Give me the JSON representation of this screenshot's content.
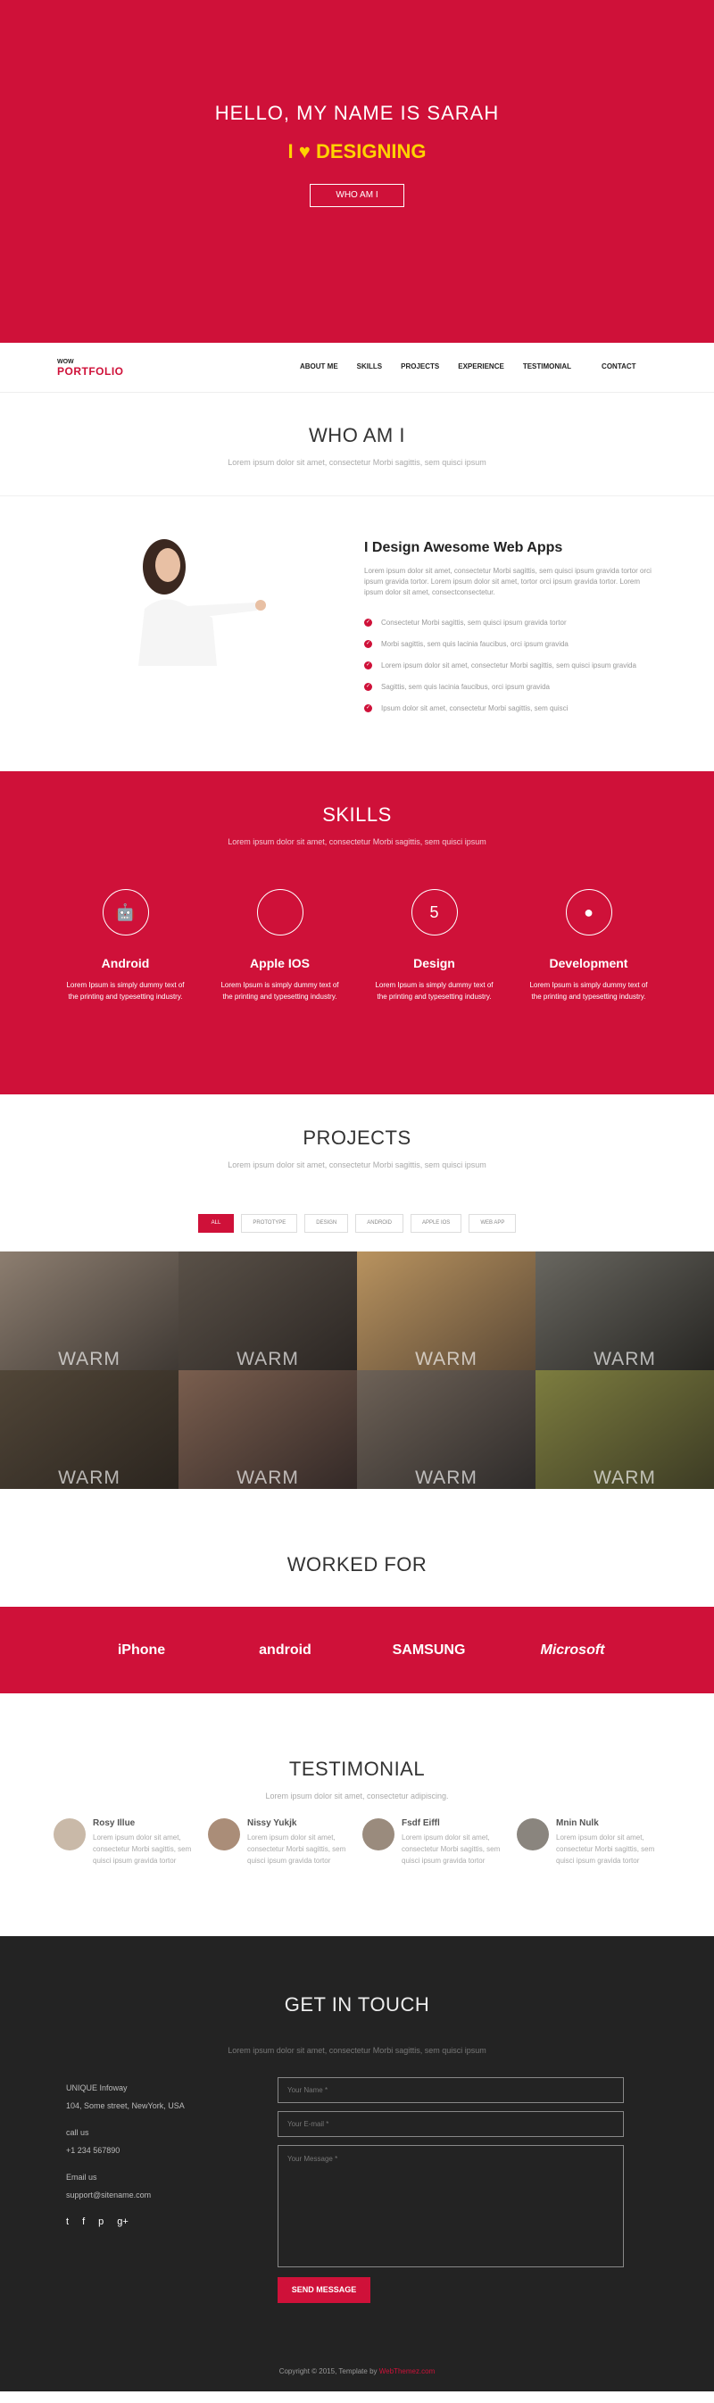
{
  "hero": {
    "title": "HELLO, MY NAME IS SARAH",
    "love_left": "I",
    "love_right": "DESIGNING",
    "button": "WHO AM I"
  },
  "logo": {
    "top": "WOW",
    "bottom": "PORTFOLIO"
  },
  "nav": [
    "ABOUT ME",
    "SKILLS",
    "PROJECTS",
    "EXPERIENCE",
    "TESTIMONIAL",
    "CONTACT"
  ],
  "who": {
    "title": "WHO AM I",
    "subtitle": "Lorem ipsum dolor sit amet, consectetur Morbi sagittis, sem quisci ipsum"
  },
  "about": {
    "heading": "I Design Awesome Web Apps",
    "text": "Lorem ipsum dolor sit amet, consectetur Morbi sagittis, sem quisci ipsum gravida tortor orci ipsum gravida tortor. Lorem ipsum dolor sit amet, tortor orci ipsum gravida tortor. Lorem ipsum dolor sit amet, consectconsectetur.",
    "checks": [
      "Consectetur Morbi sagittis, sem quisci ipsum gravida tortor",
      "Morbi sagittis, sem quis lacinia faucibus, orci ipsum gravida",
      "Lorem ipsum dolor sit amet, consectetur Morbi sagittis, sem quisci ipsum gravida",
      "Sagittis, sem quis lacinia faucibus, orci ipsum gravida",
      "Ipsum dolor sit amet, consectetur Morbi sagittis, sem quisci"
    ]
  },
  "skills": {
    "title": "SKILLS",
    "subtitle": "Lorem ipsum dolor sit amet, consectetur Morbi sagittis, sem quisci ipsum",
    "items": [
      {
        "name": "Android",
        "icon": "android",
        "desc": "Lorem Ipsum is simply dummy text of the printing and typesetting industry."
      },
      {
        "name": "Apple IOS",
        "icon": "apple",
        "desc": "Lorem Ipsum is simply dummy text of the printing and typesetting industry."
      },
      {
        "name": "Design",
        "icon": "html5",
        "desc": "Lorem Ipsum is simply dummy text of the printing and typesetting industry."
      },
      {
        "name": "Development",
        "icon": "user",
        "desc": "Lorem Ipsum is simply dummy text of the printing and typesetting industry."
      }
    ]
  },
  "projects": {
    "title": "PROJECTS",
    "subtitle": "Lorem ipsum dolor sit amet, consectetur Morbi sagittis, sem quisci ipsum",
    "filters": [
      "ALL",
      "PROTOTYPE",
      "DESIGN",
      "ANDROID",
      "APPLE IOS",
      "WEB APP"
    ],
    "tiles": [
      "WARM",
      "WARM",
      "WARM",
      "WARM",
      "WARM",
      "WARM",
      "WARM",
      "WARM"
    ]
  },
  "worked": {
    "title": "WORKED FOR",
    "brands": [
      "iPhone",
      "android",
      "SAMSUNG",
      "Microsoft"
    ]
  },
  "testimonial": {
    "title": "TESTIMONIAL",
    "subtitle": "Lorem ipsum dolor sit amet, consectetur adipiscing.",
    "items": [
      {
        "name": "Rosy Illue",
        "text": "Lorem ipsum dolor sit amet, consectetur Morbi sagittis, sem quisci ipsum gravida tortor"
      },
      {
        "name": "Nissy Yukjk",
        "text": "Lorem ipsum dolor sit amet, consectetur Morbi sagittis, sem quisci ipsum gravida tortor"
      },
      {
        "name": "Fsdf Eiffl",
        "text": "Lorem ipsum dolor sit amet, consectetur Morbi sagittis, sem quisci ipsum gravida tortor"
      },
      {
        "name": "Mnin Nulk",
        "text": "Lorem ipsum dolor sit amet, consectetur Morbi sagittis, sem quisci ipsum gravida tortor"
      }
    ]
  },
  "contact": {
    "title": "GET IN TOUCH",
    "subtitle": "Lorem ipsum dolor sit amet, consectetur Morbi sagittis, sem quisci ipsum",
    "company": "UNIQUE Infoway",
    "address": "104, Some street, NewYork, USA",
    "call_label": "call us",
    "phone": "+1 234 567890",
    "email_label": "Email us",
    "email": "support@sitename.com",
    "name_placeholder": "Your Name *",
    "email_placeholder": "Your E-mail *",
    "message_placeholder": "Your Message *",
    "send": "SEND MESSAGE"
  },
  "footer": {
    "text": "Copyright © 2015, Template by",
    "link": "WebThemez.com"
  }
}
